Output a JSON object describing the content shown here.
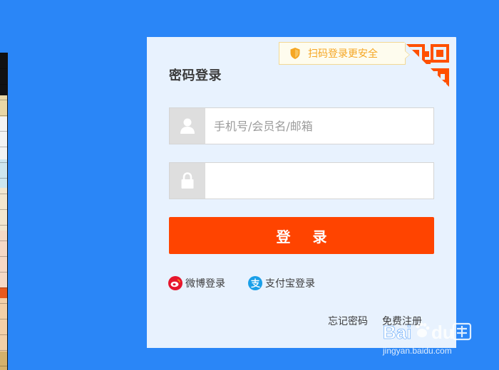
{
  "login": {
    "title": "密码登录",
    "qr_tip": "扫码登录更安全",
    "username": {
      "placeholder": "手机号/会员名/邮箱",
      "value": ""
    },
    "password": {
      "placeholder": "",
      "value": ""
    },
    "login_label": "登 录",
    "social": [
      {
        "label": "微博登录",
        "icon": "weibo-icon"
      },
      {
        "label": "支付宝登录",
        "icon": "alipay-icon"
      }
    ],
    "forgot_label": "忘记密码",
    "register_label": "免费注册"
  },
  "watermark": {
    "site": "jingyan.baidu.com"
  },
  "colors": {
    "page_background": "#2a86f7",
    "panel_background": "#e8f2fe",
    "accent": "#ff4400",
    "qr_tip_text": "#f5a623",
    "weibo": "#e6162d",
    "alipay": "#1a9fe8"
  }
}
